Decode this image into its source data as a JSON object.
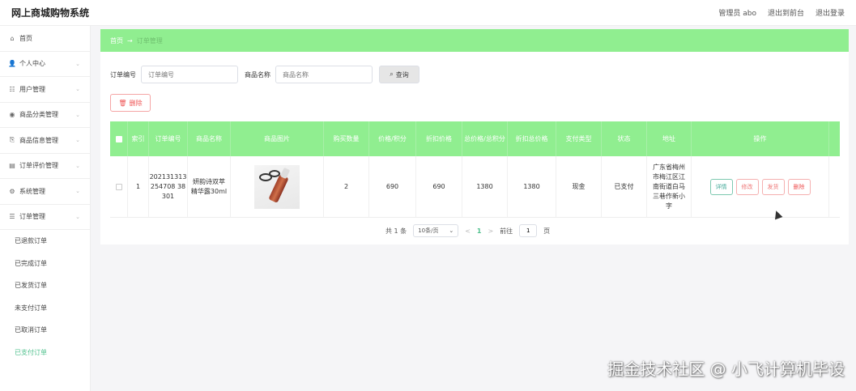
{
  "header": {
    "title": "网上商城购物系统",
    "admin": "管理员 abo",
    "front": "退出到前台",
    "logout": "退出登录"
  },
  "sidebar": {
    "items": [
      {
        "label": "首页",
        "icon": "home-icon",
        "glyph": "⌂",
        "has_arrow": false
      },
      {
        "label": "个人中心",
        "icon": "user-icon",
        "glyph": "👤",
        "has_arrow": true
      },
      {
        "label": "用户管理",
        "icon": "users-icon",
        "glyph": "☷",
        "has_arrow": true
      },
      {
        "label": "商品分类管理",
        "icon": "category-icon",
        "glyph": "◉",
        "has_arrow": true
      },
      {
        "label": "商品信息管理",
        "icon": "product-icon",
        "glyph": "⎘",
        "has_arrow": true
      },
      {
        "label": "订单评价管理",
        "icon": "review-icon",
        "glyph": "▤",
        "has_arrow": true
      },
      {
        "label": "系统管理",
        "icon": "system-icon",
        "glyph": "⚙",
        "has_arrow": true
      },
      {
        "label": "订单管理",
        "icon": "order-icon",
        "glyph": "☰",
        "has_arrow": true
      }
    ],
    "sub_items": [
      {
        "label": "已退款订单",
        "active": false
      },
      {
        "label": "已完成订单",
        "active": false
      },
      {
        "label": "已发货订单",
        "active": false
      },
      {
        "label": "未支付订单",
        "active": false
      },
      {
        "label": "已取消订单",
        "active": false
      },
      {
        "label": "已支付订单",
        "active": true
      }
    ]
  },
  "breadcrumb": {
    "home": "首页",
    "sep": "→",
    "current": "订单管理"
  },
  "search": {
    "order_label": "订单编号",
    "order_placeholder": "订单编号",
    "name_label": "商品名称",
    "name_placeholder": "商品名称",
    "button": "查询"
  },
  "toolbar": {
    "delete": "删除"
  },
  "table": {
    "headers": [
      "索引",
      "订单编号",
      "商品名称",
      "商品图片",
      "购买数量",
      "价格/积分",
      "折扣价格",
      "总价格/总积分",
      "折扣总价格",
      "支付类型",
      "状态",
      "地址",
      "操作"
    ],
    "rows": [
      {
        "index": "1",
        "order_no": "20213131325470838301",
        "order_no_lines": [
          "202131313",
          "254708 38",
          "301"
        ],
        "name_lines": [
          "妍韵诗双萃",
          "精华露30ml"
        ],
        "qty": "2",
        "price": "690",
        "discount_price": "690",
        "total": "1380",
        "discount_total": "1380",
        "pay_type": "现金",
        "status": "已支付",
        "address_lines": [
          "广东省梅州",
          "市梅江区江",
          "南街道白马",
          "三巷作新小",
          "字"
        ]
      }
    ],
    "actions": {
      "detail": "详情",
      "edit": "修改",
      "ship": "发货",
      "delete": "删除"
    }
  },
  "pagination": {
    "total": "共 1 条",
    "page_size": "10条/页",
    "prev": "<",
    "current": "1",
    "next": ">",
    "goto_label": "前往",
    "goto_value": "1",
    "page_unit": "页"
  },
  "watermark": "掘金技术社区 @ 小飞计算机毕设",
  "colors": {
    "accent_green": "#90ee90",
    "active_text": "#4fc08d",
    "danger": "#ee5555"
  }
}
